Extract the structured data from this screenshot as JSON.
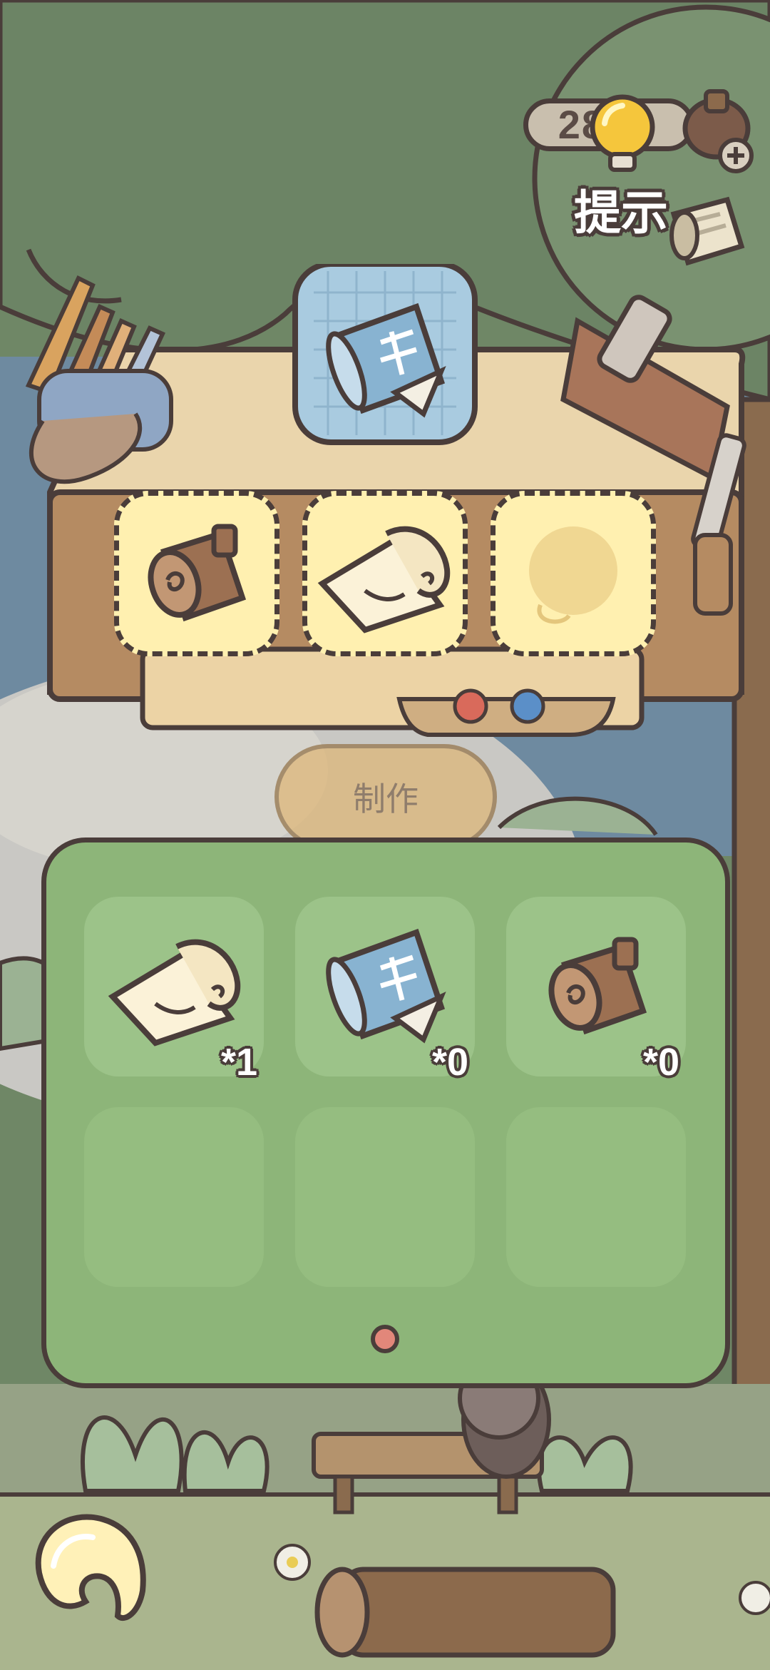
{
  "hint": {
    "count": "2819",
    "label": "提示"
  },
  "workbench": {
    "target_item_icon": "blueprint-icon",
    "ingredient_slots": [
      {
        "icon": "log-icon",
        "filled": true
      },
      {
        "icon": "paper-roll-icon",
        "filled": true
      },
      {
        "icon": "yarn-ball-icon",
        "filled": false
      }
    ]
  },
  "craft_button": {
    "label": "制作"
  },
  "inventory": {
    "items": [
      {
        "icon": "paper-roll-icon",
        "qty": "*1"
      },
      {
        "icon": "blueprint-icon",
        "qty": "*0"
      },
      {
        "icon": "log-icon",
        "qty": "*0"
      }
    ],
    "page_indicator": {
      "current": 1,
      "total": 1
    }
  },
  "back_button": {
    "icon": "back-arrow-icon"
  },
  "colors": {
    "panel": "#8db579",
    "outline": "#4a3d3a",
    "slot_highlight": "#fff0b0",
    "page_dot": "#e2877a"
  }
}
